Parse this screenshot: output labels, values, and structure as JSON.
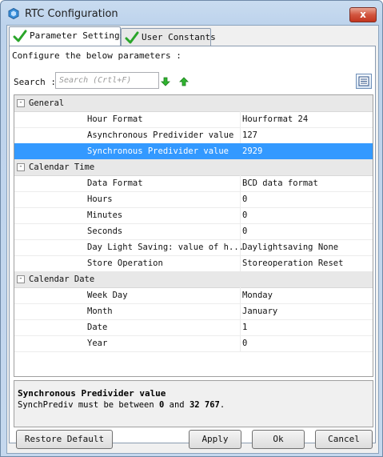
{
  "window": {
    "title": "RTC Configuration",
    "close_label": "x"
  },
  "tabs": [
    {
      "label": "Parameter Settings",
      "active": true
    },
    {
      "label": "User Constants",
      "active": false
    }
  ],
  "description": "Configure the below parameters :",
  "search": {
    "label": "Search :",
    "placeholder": "Search (Crtl+F)"
  },
  "groups": [
    {
      "name": "General",
      "expanded_symbol": "-",
      "rows": [
        {
          "name": "Hour Format",
          "value": "Hourformat 24"
        },
        {
          "name": "Asynchronous Predivider value",
          "value": "127"
        },
        {
          "name": "Synchronous Predivider value",
          "value": "2929",
          "selected": true
        }
      ]
    },
    {
      "name": "Calendar Time",
      "expanded_symbol": "-",
      "rows": [
        {
          "name": "Data Format",
          "value": "BCD data format"
        },
        {
          "name": "Hours",
          "value": "0"
        },
        {
          "name": "Minutes",
          "value": "0"
        },
        {
          "name": "Seconds",
          "value": "0"
        },
        {
          "name": "Day Light Saving: value of h...",
          "value": "Daylightsaving None"
        },
        {
          "name": "Store Operation",
          "value": "Storeoperation Reset"
        }
      ]
    },
    {
      "name": "Calendar Date",
      "expanded_symbol": "-",
      "rows": [
        {
          "name": "Week Day",
          "value": "Monday"
        },
        {
          "name": "Month",
          "value": "January"
        },
        {
          "name": "Date",
          "value": "1"
        },
        {
          "name": "Year",
          "value": "0"
        }
      ]
    }
  ],
  "help": {
    "title": "Synchronous Predivider value",
    "text_prefix": "SynchPrediv must be between ",
    "min": "0",
    "text_middle": " and ",
    "max": "32 767",
    "text_suffix": "."
  },
  "buttons": {
    "restore": "Restore Default",
    "apply": "Apply",
    "ok": "Ok",
    "cancel": "Cancel"
  },
  "colors": {
    "selection": "#3399ff",
    "check_green": "#2aa52a",
    "arrow_green": "#2fb52f",
    "close_red": "#c7432d"
  },
  "icons": {
    "app": "hexagon-chip-icon",
    "tab_check": "green-check-icon",
    "search_next": "green-down-arrow-icon",
    "search_prev": "green-up-arrow-icon",
    "view": "list-view-icon"
  }
}
